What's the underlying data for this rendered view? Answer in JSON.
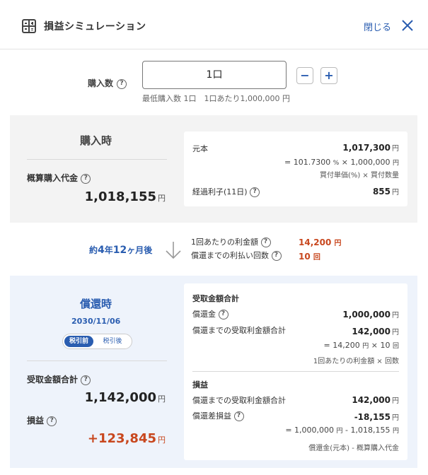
{
  "header": {
    "title": "損益シミュレーション",
    "close_label": "閉じる"
  },
  "quantity": {
    "label": "購入数",
    "value": "1口",
    "minus": "−",
    "plus": "+",
    "note": "最低購入数 1口　1口あたり1,000,000 円"
  },
  "purchase": {
    "title": "購入時",
    "estimated_label": "概算購入代金",
    "estimated_value": "1,018,155",
    "yen": "円",
    "principal_label": "元本",
    "principal_value": "1,017,300",
    "principal_formula_a": "= 101.7300",
    "principal_formula_pct": "%",
    "principal_formula_b": "× 1,000,000",
    "principal_formula_note": "買付単価(%) × 買付数量",
    "interest_label": "経過利子(11日)",
    "interest_value": "855"
  },
  "middle": {
    "period_prefix": "約",
    "period_years": "4",
    "period_years_unit": "年",
    "period_months": "12",
    "period_months_unit": "ヶ月後",
    "per_payment_label": "1回あたりの利金額",
    "per_payment_value": "14,200",
    "per_payment_unit": "円",
    "count_label": "償還までの利払い回数",
    "count_value": "10",
    "count_unit": "回"
  },
  "redemption": {
    "title": "償還時",
    "date": "2030/11/06",
    "tab_pre_tax": "税引前",
    "tab_post_tax": "税引後",
    "received_total_label": "受取金額合計",
    "received_total_value": "1,142,000",
    "pnl_label": "損益",
    "pnl_value": "+123,845",
    "yen": "円",
    "card_received_heading": "受取金額合計",
    "redemption_amount_label": "償還金",
    "redemption_amount_value": "1,000,000",
    "interest_total_label": "償還までの受取利金額合計",
    "interest_total_value": "142,000",
    "interest_formula_a": "= 14,200",
    "interest_formula_b": "× 10",
    "interest_formula_unit_b": "回",
    "interest_formula_note": "1回あたりの利金額 × 回数",
    "card_pnl_heading": "損益",
    "pnl_interest_label": "償還までの受取利金額合計",
    "pnl_interest_value": "142,000",
    "pnl_diff_label": "償還差損益",
    "pnl_diff_value": "-18,155",
    "pnl_diff_formula_a": "= 1,000,000",
    "pnl_diff_formula_b": "- 1,018,155",
    "pnl_diff_formula_note": "償還金(元本) - 概算購入代金"
  },
  "colors": {
    "brand_blue": "#2a5db0",
    "accent_orange": "#c8471e",
    "purchase_bg": "#f3f3f3",
    "redeem_bg": "#eef3fb"
  }
}
